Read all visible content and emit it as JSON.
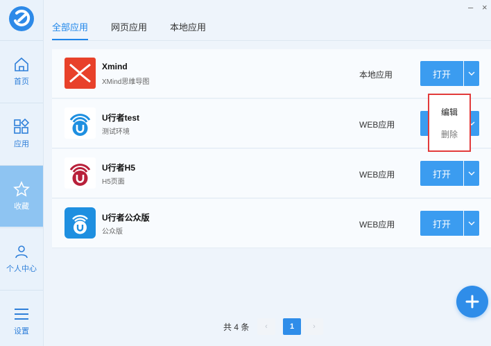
{
  "window": {
    "minimize": "–",
    "close": "×"
  },
  "sidebar": {
    "items": [
      {
        "label": "首页",
        "icon": "home-icon"
      },
      {
        "label": "应用",
        "icon": "apps-icon"
      },
      {
        "label": "收藏",
        "icon": "star-icon",
        "active": true
      },
      {
        "label": "个人中心",
        "icon": "user-icon"
      },
      {
        "label": "设置",
        "icon": "menu-icon"
      }
    ]
  },
  "tabs": [
    {
      "label": "全部应用",
      "active": true
    },
    {
      "label": "网页应用"
    },
    {
      "label": "本地应用"
    }
  ],
  "apps": [
    {
      "name": "Xmind",
      "desc": "XMind思维导图",
      "type": "本地应用",
      "open": "打开",
      "icon": "xmind-icon"
    },
    {
      "name": "U行者test",
      "desc": "测试环境",
      "type": "WEB应用",
      "open": "打开",
      "icon": "uxingzhe-icon"
    },
    {
      "name": "U行者H5",
      "desc": "H5页面",
      "type": "WEB应用",
      "open": "打开",
      "icon": "uxingzhe-h5-icon"
    },
    {
      "name": "U行者公众版",
      "desc": "公众版",
      "type": "WEB应用",
      "open": "打开",
      "icon": "uxingzhe-public-icon"
    }
  ],
  "menu": {
    "edit": "编辑",
    "delete": "删除"
  },
  "pagination": {
    "total": "共 4 条",
    "current": "1",
    "prev": "‹",
    "next": "›"
  },
  "colors": {
    "primary": "#3b9cf0",
    "active_nav": "#8ec4f2",
    "menu_border": "#e23a3a"
  }
}
